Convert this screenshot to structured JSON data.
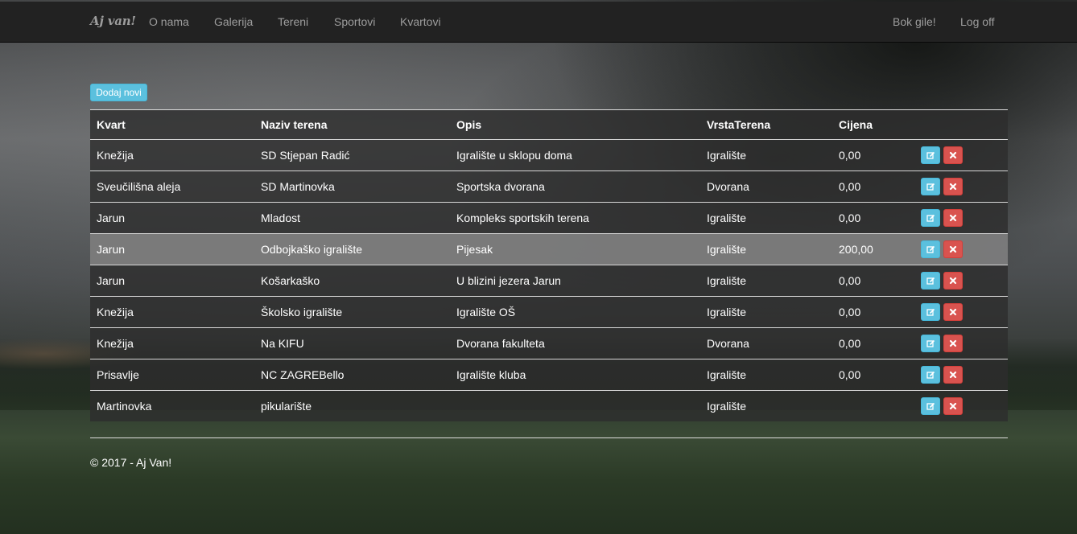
{
  "navbar": {
    "brand": "Aj van!",
    "links": [
      "O nama",
      "Galerija",
      "Tereni",
      "Sportovi",
      "Kvartovi"
    ],
    "greeting": "Bok gile!",
    "logoff": "Log off"
  },
  "add_button": "Dodaj novi",
  "table": {
    "headers": [
      "Kvart",
      "Naziv terena",
      "Opis",
      "VrstaTerena",
      "Cijena"
    ],
    "rows": [
      [
        "Knežija",
        "SD Stjepan Radić",
        "Igralište u sklopu doma",
        "Igralište",
        "0,00"
      ],
      [
        "Sveučilišna aleja",
        "SD Martinovka",
        "Sportska dvorana",
        "Dvorana",
        "0,00"
      ],
      [
        "Jarun",
        "Mladost",
        "Kompleks sportskih terena",
        "Igralište",
        "0,00"
      ],
      [
        "Jarun",
        "Odbojkaško igralište",
        "Pijesak",
        "Igralište",
        "200,00"
      ],
      [
        "Jarun",
        "Košarkaško",
        "U blizini jezera Jarun",
        "Igralište",
        "0,00"
      ],
      [
        "Knežija",
        "Školsko igralište",
        "Igralište OŠ",
        "Igralište",
        "0,00"
      ],
      [
        "Knežija",
        "Na KIFU",
        "Dvorana fakulteta",
        "Dvorana",
        "0,00"
      ],
      [
        "Prisavlje",
        "NC ZAGREBello",
        "Igralište kluba",
        "Igralište",
        "0,00"
      ],
      [
        "Martinovka",
        "pikularište",
        "",
        "Igralište",
        ""
      ]
    ],
    "highlighted_row": 3,
    "row_actions": [
      "edit-icon",
      "remove-icon"
    ]
  },
  "footer": "© 2017 - Aj Van!",
  "colors": {
    "navbar": "#222222",
    "nav_text": "#9d9d9d",
    "info": "#5bc0de",
    "danger": "#d9534f"
  }
}
